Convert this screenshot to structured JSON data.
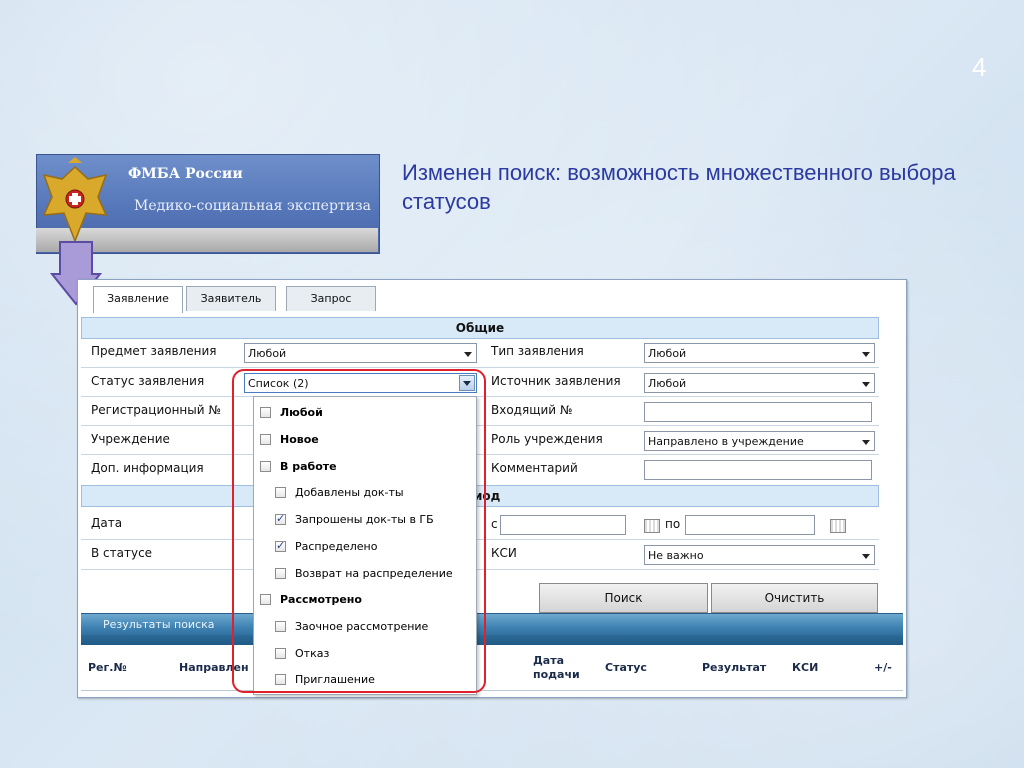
{
  "slide": {
    "number": "4",
    "title": "Изменен поиск: возможность множественного выбора статусов"
  },
  "logo": {
    "title": "ФМБА России",
    "subtitle": "Медико-социальная экспертиза"
  },
  "tabs": [
    "Заявление",
    "Заявитель",
    "Запрос"
  ],
  "sections": {
    "general": "Общие",
    "period_partial": "иод"
  },
  "form": {
    "subject_label": "Предмет заявления",
    "subject_value": "Любой",
    "status_label": "Статус заявления",
    "status_value": "Список (2)",
    "reg_label": "Регистрационный №",
    "institution_label": "Учреждение",
    "extra_label": "Доп. информация",
    "date_label": "Дата",
    "in_status_label": "В статусе",
    "type_label": "Тип заявления",
    "type_value": "Любой",
    "source_label": "Источник заявления",
    "source_value": "Любой",
    "incoming_label": "Входящий №",
    "incoming_value": "",
    "role_label": "Роль учреждения",
    "role_value": "Направлено в учреждение",
    "comment_label": "Комментарий",
    "comment_value": "",
    "date_from_label": "с",
    "date_to_label": "по",
    "ksi_label": "КСИ",
    "ksi_value": "Не важно"
  },
  "buttons": {
    "search": "Поиск",
    "clear": "Очистить"
  },
  "results": {
    "label": "Результаты поиска",
    "columns": [
      "Рег.№",
      "Направлен",
      "Дата\nподачи",
      "Статус",
      "Результат",
      "КСИ",
      "+/-"
    ]
  },
  "status_options": [
    {
      "label": "Любой",
      "checked": false,
      "bold": true,
      "indent": false
    },
    {
      "label": "Новое",
      "checked": false,
      "bold": true,
      "indent": false
    },
    {
      "label": "В работе",
      "checked": false,
      "bold": true,
      "indent": false
    },
    {
      "label": "Добавлены док-ты",
      "checked": false,
      "bold": false,
      "indent": true
    },
    {
      "label": "Запрошены док-ты в ГБ",
      "checked": true,
      "bold": false,
      "indent": true
    },
    {
      "label": "Распределено",
      "checked": true,
      "bold": false,
      "indent": true
    },
    {
      "label": "Возврат на распределение",
      "checked": false,
      "bold": false,
      "indent": true
    },
    {
      "label": "Рассмотрено",
      "checked": false,
      "bold": true,
      "indent": false
    },
    {
      "label": "Заочное рассмотрение",
      "checked": false,
      "bold": false,
      "indent": true
    },
    {
      "label": "Отказ",
      "checked": false,
      "bold": false,
      "indent": true
    },
    {
      "label": "Приглашение",
      "checked": false,
      "bold": false,
      "indent": true
    }
  ]
}
